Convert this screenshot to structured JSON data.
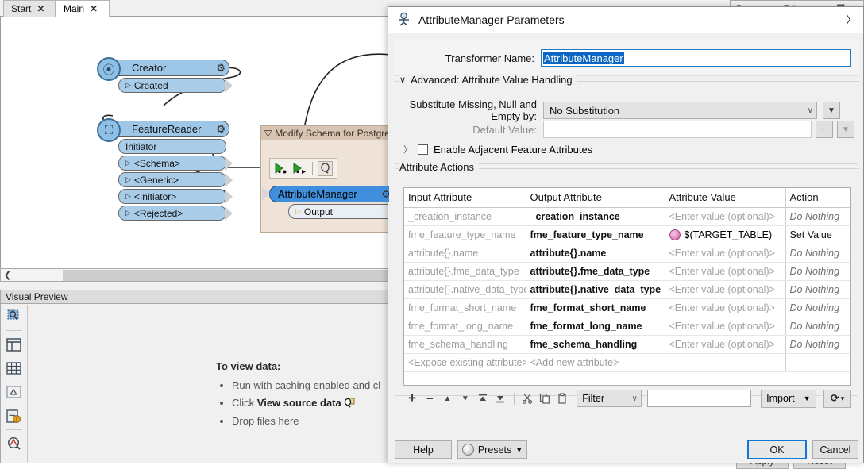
{
  "tabs": [
    {
      "label": "Start",
      "close": "✕",
      "active": false
    },
    {
      "label": "Main",
      "close": "✕",
      "active": true
    }
  ],
  "workspace": {
    "creator": {
      "title": "Creator",
      "gear": "⚙",
      "ports": [
        {
          "label": "Created",
          "tri": "▷"
        }
      ]
    },
    "feature_reader": {
      "title": "FeatureReader",
      "gear": "⚙",
      "ports": [
        {
          "label": "Initiator",
          "tri": ""
        },
        {
          "label": "<Schema>",
          "tri": "▷"
        },
        {
          "label": "<Generic>",
          "tri": "▷"
        },
        {
          "label": "<Initiator>",
          "tri": "▷"
        },
        {
          "label": "<Rejected>",
          "tri": "▷"
        }
      ]
    },
    "bookmark": {
      "title": "Modify Schema for Postgre",
      "collapse_icon": "▽",
      "tools": [
        "attribute-in-icon",
        "attribute-out-icon",
        "inspect-icon"
      ],
      "node": {
        "title": "AttributeManager",
        "gear": "⚙",
        "ports": [
          {
            "label": "Output",
            "tri": "▷"
          }
        ]
      }
    }
  },
  "visual_preview": {
    "title": "Visual Preview",
    "rail_icons": [
      "select-tool-icon",
      "layout-panel-icon",
      "table-view-icon",
      "graphics-view-icon",
      "feature-info-icon",
      "inspect-point-icon"
    ],
    "message": {
      "heading": "To view data:",
      "items": [
        "Run with caching enabled and cl",
        "Click View source data",
        "Drop files here"
      ],
      "bold_fragment": "View source data",
      "source_data_icon": "🔍"
    }
  },
  "parameter_editor": {
    "title": "Parameter Editor",
    "undock_icon": "❐",
    "close_icon": "✕",
    "expand_icon": "〉",
    "apply_label": "Apply",
    "reset_label": "Reset"
  },
  "dialog": {
    "title": "AttributeManager Parameters",
    "icon": "transformer-icon",
    "close_icon": "〉",
    "transformer_name": {
      "label": "Transformer Name:",
      "value": "AttributeManager",
      "selected": true
    },
    "advanced": {
      "legend": "Advanced: Attribute Value Handling",
      "chevron": "∨",
      "substitute": {
        "label": "Substitute Missing, Null and Empty by:",
        "value": "No Substitution",
        "arrow": "∨",
        "side_button": "▼"
      },
      "default_value": {
        "label": "Default Value:",
        "value": "",
        "ellipsis_button": "⋯",
        "side_button": "▼"
      },
      "adjacent": {
        "label": "Enable Adjacent Feature Attributes",
        "chevron": "〉",
        "checked": false
      }
    },
    "attribute_actions": {
      "legend": "Attribute Actions",
      "columns": [
        "Input Attribute",
        "Output Attribute",
        "Attribute Value",
        "Action"
      ],
      "value_placeholder": "<Enter value (optional)>",
      "rows": [
        {
          "input": "_creation_instance",
          "output": "_creation_instance",
          "value": "<Enter value (optional)>",
          "value_is_placeholder": true,
          "has_badge": false,
          "action": "Do Nothing",
          "action_dim": true
        },
        {
          "input": "fme_feature_type_name",
          "output": "fme_feature_type_name",
          "value": "$(TARGET_TABLE)",
          "value_is_placeholder": false,
          "has_badge": true,
          "action": "Set Value",
          "action_dim": false
        },
        {
          "input": "attribute{}.name",
          "output": "attribute{}.name",
          "value": "<Enter value (optional)>",
          "value_is_placeholder": true,
          "has_badge": false,
          "action": "Do Nothing",
          "action_dim": true
        },
        {
          "input": "attribute{}.fme_data_type",
          "output": "attribute{}.fme_data_type",
          "value": "<Enter value (optional)>",
          "value_is_placeholder": true,
          "has_badge": false,
          "action": "Do Nothing",
          "action_dim": true
        },
        {
          "input": "attribute{}.native_data_type",
          "output": "attribute{}.native_data_type",
          "value": "<Enter value (optional)>",
          "value_is_placeholder": true,
          "has_badge": false,
          "action": "Do Nothing",
          "action_dim": true
        },
        {
          "input": "fme_format_short_name",
          "output": "fme_format_short_name",
          "value": "<Enter value (optional)>",
          "value_is_placeholder": true,
          "has_badge": false,
          "action": "Do Nothing",
          "action_dim": true
        },
        {
          "input": "fme_format_long_name",
          "output": "fme_format_long_name",
          "value": "<Enter value (optional)>",
          "value_is_placeholder": true,
          "has_badge": false,
          "action": "Do Nothing",
          "action_dim": true
        },
        {
          "input": "fme_schema_handling",
          "output": "fme_schema_handling",
          "value": "<Enter value (optional)>",
          "value_is_placeholder": true,
          "has_badge": false,
          "action": "Do Nothing",
          "action_dim": true
        },
        {
          "input": "<Expose existing attribute>",
          "output": "<Add new attribute>",
          "value": "",
          "value_is_placeholder": true,
          "has_badge": false,
          "action": "",
          "action_dim": true
        }
      ],
      "toolbar": {
        "add": "+",
        "remove": "−",
        "move_up": "▲",
        "move_down": "▼",
        "move_top": "⤒",
        "move_bottom": "⤓",
        "cut": "✂",
        "copy": "⧉",
        "paste": "⎕",
        "filter_label": "Filter",
        "filter_arrow": "∨",
        "filter_value": "",
        "import_label": "Import",
        "import_arrow": "▼",
        "refresh_icon": "⟳",
        "refresh_arrow": "▾"
      }
    },
    "footer": {
      "help": "Help",
      "presets": "Presets",
      "presets_arrow": "▼",
      "ok": "OK",
      "cancel": "Cancel"
    }
  },
  "colors": {
    "accent_blue": "#1277d4",
    "selection_blue": "#0a66c2",
    "node_blue": "#9ec6e6",
    "node_selected": "#3f8fdc",
    "bookmark": "#efe3d8"
  }
}
